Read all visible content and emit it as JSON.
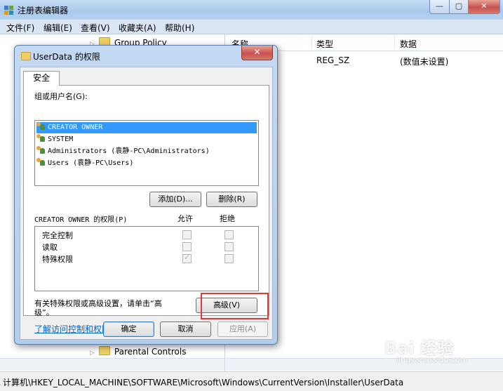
{
  "window": {
    "title": "注册表编辑器",
    "controls": {
      "minimize": "—",
      "maximize": "▢",
      "close": "✕"
    }
  },
  "menu": [
    "文件(F)",
    "编辑(E)",
    "查看(V)",
    "收藏夹(A)",
    "帮助(H)"
  ],
  "tree": {
    "items": [
      {
        "label": "Group Policy"
      },
      {
        "label": "Parental Controls"
      }
    ]
  },
  "list": {
    "columns": [
      "名称",
      "类型",
      "数据"
    ],
    "rows": [
      {
        "type": "REG_SZ",
        "data": "(数值未设置)"
      }
    ]
  },
  "statusbar": "计算机\\HKEY_LOCAL_MACHINE\\SOFTWARE\\Microsoft\\Windows\\CurrentVersion\\Installer\\UserData",
  "dialog": {
    "title": "UserData 的权限",
    "close": "✕",
    "tab": "安全",
    "group_label": "组或用户名(G):",
    "users": [
      "CREATOR OWNER",
      "SYSTEM",
      "Administrators (袁静-PC\\Administrators)",
      "Users (袁静-PC\\Users)"
    ],
    "selected_user_index": 0,
    "add_button": "添加(D)...",
    "remove_button": "删除(R)",
    "perm_label": "CREATOR OWNER 的权限(P)",
    "allow_header": "允许",
    "deny_header": "拒绝",
    "permissions": [
      {
        "name": "完全控制",
        "allow": false,
        "deny": false
      },
      {
        "name": "读取",
        "allow": false,
        "deny": false
      },
      {
        "name": "特殊权限",
        "allow": true,
        "deny": false
      }
    ],
    "advanced_text_line1": "有关特殊权限或高级设置，请单击“高",
    "advanced_text_line2": "级”。",
    "advanced_button": "高级(V)",
    "help_link": "了解访问控制和权限",
    "ok_button": "确定",
    "cancel_button": "取消",
    "apply_button": "应用(A)"
  },
  "watermark": {
    "logo": "Bai 经验",
    "url": "jingyan.baidu.com"
  }
}
